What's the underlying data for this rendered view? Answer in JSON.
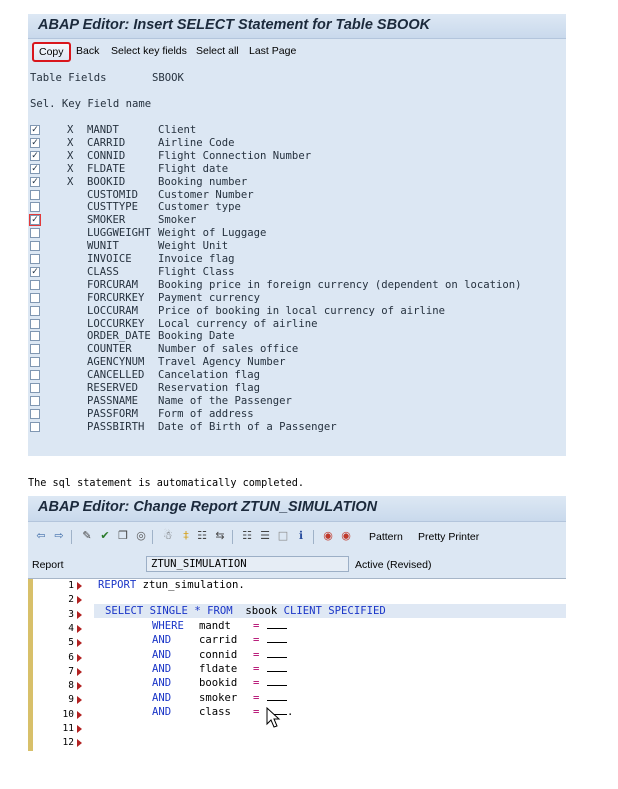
{
  "panel1": {
    "title": "ABAP Editor: Insert SELECT Statement for Table SBOOK",
    "toolbar": [
      "Copy",
      "Back",
      "Select key fields",
      "Select all",
      "Last Page"
    ],
    "table_fields_label": "Table Fields",
    "table_name": "SBOOK",
    "col_header": "Sel. Key Field name",
    "fields": [
      {
        "checked": true,
        "key": "X",
        "name": "MANDT",
        "desc": "Client"
      },
      {
        "checked": true,
        "key": "X",
        "name": "CARRID",
        "desc": "Airline Code"
      },
      {
        "checked": true,
        "key": "X",
        "name": "CONNID",
        "desc": "Flight Connection Number"
      },
      {
        "checked": true,
        "key": "X",
        "name": "FLDATE",
        "desc": "Flight date"
      },
      {
        "checked": true,
        "key": "X",
        "name": "BOOKID",
        "desc": "Booking number"
      },
      {
        "checked": false,
        "key": "",
        "name": "CUSTOMID",
        "desc": "Customer Number"
      },
      {
        "checked": false,
        "key": "",
        "name": "CUSTTYPE",
        "desc": "Customer type"
      },
      {
        "checked": true,
        "key": "",
        "name": "SMOKER",
        "desc": "Smoker",
        "highlight": true
      },
      {
        "checked": false,
        "key": "",
        "name": "LUGGWEIGHT",
        "desc": "Weight of Luggage"
      },
      {
        "checked": false,
        "key": "",
        "name": "WUNIT",
        "desc": "Weight Unit"
      },
      {
        "checked": false,
        "key": "",
        "name": "INVOICE",
        "desc": "Invoice flag"
      },
      {
        "checked": true,
        "key": "",
        "name": "CLASS",
        "desc": "Flight Class"
      },
      {
        "checked": false,
        "key": "",
        "name": "FORCURAM",
        "desc": "Booking price in foreign currency (dependent on location)"
      },
      {
        "checked": false,
        "key": "",
        "name": "FORCURKEY",
        "desc": "Payment currency"
      },
      {
        "checked": false,
        "key": "",
        "name": "LOCCURAM",
        "desc": "Price of booking in local currency of airline"
      },
      {
        "checked": false,
        "key": "",
        "name": "LOCCURKEY",
        "desc": "Local currency of airline"
      },
      {
        "checked": false,
        "key": "",
        "name": "ORDER_DATE",
        "desc": "Booking Date"
      },
      {
        "checked": false,
        "key": "",
        "name": "COUNTER",
        "desc": "Number of sales office"
      },
      {
        "checked": false,
        "key": "",
        "name": "AGENCYNUM",
        "desc": "Travel Agency Number"
      },
      {
        "checked": false,
        "key": "",
        "name": "CANCELLED",
        "desc": "Cancelation flag"
      },
      {
        "checked": false,
        "key": "",
        "name": "RESERVED",
        "desc": "Reservation flag"
      },
      {
        "checked": false,
        "key": "",
        "name": "PASSNAME",
        "desc": "Name of the Passenger"
      },
      {
        "checked": false,
        "key": "",
        "name": "PASSFORM",
        "desc": "Form of address"
      },
      {
        "checked": false,
        "key": "",
        "name": "PASSBIRTH",
        "desc": "Date of Birth of a Passenger"
      }
    ]
  },
  "caption": "The sql statement is automatically completed.",
  "panel2": {
    "title": "ABAP Editor: Change Report ZTUN_SIMULATION",
    "toolbar_text": [
      "Pattern",
      "Pretty Printer"
    ],
    "report_label": "Report",
    "report_name": "ZTUN_SIMULATION",
    "status": "Active (Revised)",
    "line_numbers": [
      "1",
      "2",
      "3",
      "4",
      "5",
      "6",
      "7",
      "8",
      "9",
      "10",
      "11",
      "12"
    ],
    "code": {
      "l1_kw": "REPORT",
      "l1_rest": " ztun_simulation.",
      "l3_kw1": "SELECT SINGLE",
      "l3_star": "*",
      "l3_kw2": "FROM",
      "l3_tab": "sbook",
      "l3_kw3": "CLIENT SPECIFIED",
      "where": "WHERE",
      "and": "AND",
      "eq": "=",
      "conds": [
        "mandt",
        "carrid",
        "connid",
        "fldate",
        "bookid",
        "smoker",
        "class"
      ],
      "period": "."
    }
  }
}
